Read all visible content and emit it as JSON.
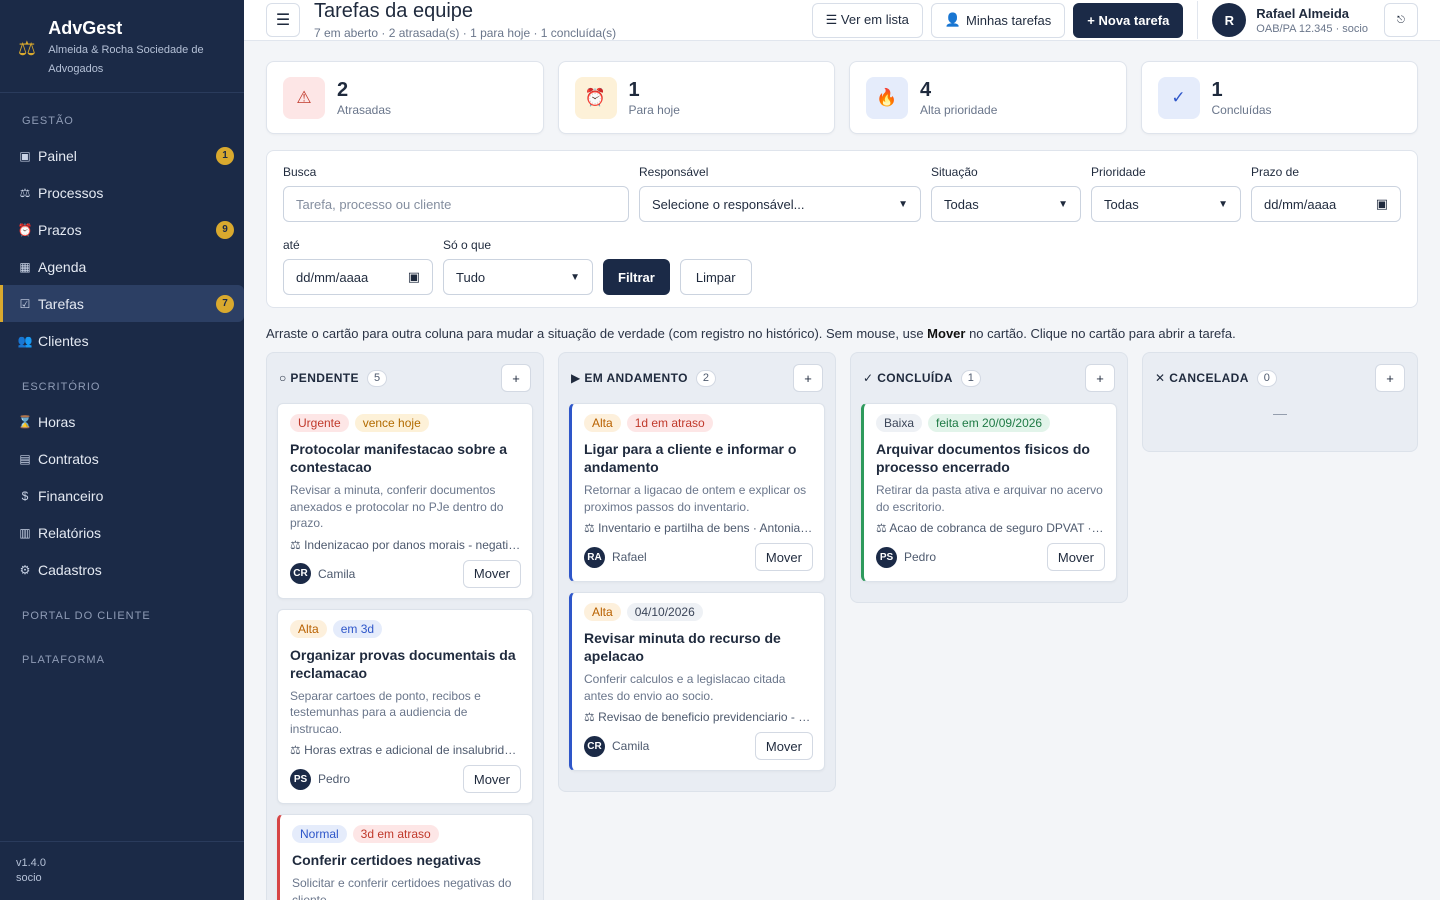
{
  "brand": {
    "name": "AdvGest",
    "subtitle": "Almeida & Rocha Sociedade de Advogados"
  },
  "sidebar": {
    "sections": [
      {
        "label": "GESTÃO",
        "items": [
          {
            "label": "Painel",
            "icon": "dashboard-icon",
            "glyph": "▣",
            "badge": "1"
          },
          {
            "label": "Processos",
            "icon": "scales-icon",
            "glyph": "⚖",
            "badge": ""
          },
          {
            "label": "Prazos",
            "icon": "alarm-icon",
            "glyph": "⏰",
            "badge": "9"
          },
          {
            "label": "Agenda",
            "icon": "calendar-icon",
            "glyph": "▦",
            "badge": ""
          },
          {
            "label": "Tarefas",
            "icon": "checkbox-icon",
            "glyph": "☑",
            "badge": "7",
            "active": true
          },
          {
            "label": "Clientes",
            "icon": "users-icon",
            "glyph": "👥",
            "badge": ""
          }
        ]
      },
      {
        "label": "ESCRITÓRIO",
        "items": [
          {
            "label": "Horas",
            "icon": "hourglass-icon",
            "glyph": "⌛",
            "badge": ""
          },
          {
            "label": "Contratos",
            "icon": "document-icon",
            "glyph": "▤",
            "badge": ""
          },
          {
            "label": "Financeiro",
            "icon": "money-bag-icon",
            "glyph": "$",
            "badge": ""
          },
          {
            "label": "Relatórios",
            "icon": "bar-chart-icon",
            "glyph": "▥",
            "badge": ""
          },
          {
            "label": "Cadastros",
            "icon": "gear-icon",
            "glyph": "⚙",
            "badge": ""
          }
        ]
      },
      {
        "label": "PORTAL DO CLIENTE",
        "items": []
      },
      {
        "label": "PLATAFORMA",
        "items": []
      }
    ],
    "version": "v1.4.0",
    "role": "socio"
  },
  "header": {
    "title": "Tarefas da equipe",
    "subtitle": "7 em aberto · 2 atrasada(s) · 1 para hoje · 1 concluída(s)",
    "btn_list": "☰ Ver em lista",
    "btn_mine": "Minhas tarefas",
    "btn_new": "+ Nova tarefa",
    "user_initial": "R",
    "user_name": "Rafael Almeida",
    "user_role": "OAB/PA 12.345 · socio"
  },
  "stats": [
    {
      "value": "2",
      "label": "Atrasadas",
      "icon": "warning-icon",
      "glyph": "⚠",
      "bg": "#fde6e6",
      "fg": "#c0392b"
    },
    {
      "value": "1",
      "label": "Para hoje",
      "icon": "alarm-clock-icon",
      "glyph": "⏰",
      "bg": "#fdf1d8",
      "fg": "#d0441f"
    },
    {
      "value": "4",
      "label": "Alta prioridade",
      "icon": "fire-icon",
      "glyph": "🔥",
      "bg": "#e5ecfb",
      "fg": "#e25822"
    },
    {
      "value": "1",
      "label": "Concluídas",
      "icon": "check-icon",
      "glyph": "✓",
      "bg": "#e5ecfb",
      "fg": "#2e56c9"
    }
  ],
  "filters": {
    "search_label": "Busca",
    "search_placeholder": "Tarefa, processo ou cliente",
    "resp_label": "Responsável",
    "resp_value": "Selecione o responsável...",
    "sit_label": "Situação",
    "sit_value": "Todas",
    "prio_label": "Prioridade",
    "prio_value": "Todas",
    "from_label": "Prazo de",
    "from_value": "dd/mm/aaaa",
    "to_label": "até",
    "to_value": "dd/mm/aaaa",
    "only_label": "Só o que",
    "only_value": "Tudo",
    "apply": "Filtrar",
    "clear": "Limpar"
  },
  "hint": {
    "before": "Arraste o cartão para outra coluna para mudar a situação de verdade (com registro no histórico). Sem mouse, use ",
    "bold": "Mover",
    "after": " no cartão. Clique no cartão para abrir a tarefa."
  },
  "board": [
    {
      "title": "○ PENDENTE",
      "count": "5",
      "add": "+",
      "empty": "",
      "cards": [
        {
          "border": "",
          "tags": [
            {
              "text": "Urgente",
              "cls": "t-urg"
            },
            {
              "text": "vence hoje",
              "cls": "t-today"
            }
          ],
          "title": "Protocolar manifestacao sobre a contestacao",
          "desc": "Revisar a minuta, conferir documentos anexados e protocolar no PJe dentro do prazo.",
          "proc": "⚖ Indenizacao por danos morais - negativacao indevida",
          "initials": "CR",
          "name": "Camila",
          "move": "Mover"
        },
        {
          "border": "",
          "tags": [
            {
              "text": "Alta",
              "cls": "t-alta"
            },
            {
              "text": "em 3d",
              "cls": "t-blue"
            }
          ],
          "title": "Organizar provas documentais da reclamacao",
          "desc": "Separar cartoes de ponto, recibos e testemunhas para a audiencia de instrucao.",
          "proc": "⚖ Horas extras e adicional de insalubridade",
          "initials": "PS",
          "name": "Pedro",
          "move": "Mover"
        },
        {
          "border": "bl-red",
          "tags": [
            {
              "text": "Normal",
              "cls": "t-normal"
            },
            {
              "text": "3d em atraso",
              "cls": "t-late"
            }
          ],
          "title": "Conferir certidoes negativas",
          "desc": "Solicitar e conferir certidoes negativas do cliente.",
          "proc": "",
          "initials": "",
          "name": "",
          "move": ""
        }
      ]
    },
    {
      "title": "▶ EM ANDAMENTO",
      "count": "2",
      "add": "+",
      "empty": "",
      "cards": [
        {
          "border": "bl-blue",
          "tags": [
            {
              "text": "Alta",
              "cls": "t-alta"
            },
            {
              "text": "1d em atraso",
              "cls": "t-late"
            }
          ],
          "title": "Ligar para a cliente e informar o andamento",
          "desc": "Retornar a ligacao de ontem e explicar os proximos passos do inventario.",
          "proc": "⚖ Inventario e partilha de bens · Antonia Pereira",
          "initials": "RA",
          "name": "Rafael",
          "move": "Mover"
        },
        {
          "border": "bl-blue",
          "tags": [
            {
              "text": "Alta",
              "cls": "t-alta"
            },
            {
              "text": "04/10/2026",
              "cls": "t-date"
            }
          ],
          "title": "Revisar minuta do recurso de apelacao",
          "desc": "Conferir calculos e a legislacao citada antes do envio ao socio.",
          "proc": "⚖ Revisao de beneficio previdenciario - aposentadoria",
          "initials": "CR",
          "name": "Camila",
          "move": "Mover"
        }
      ]
    },
    {
      "title": "✓ CONCLUÍDA",
      "count": "1",
      "add": "+",
      "empty": "",
      "cards": [
        {
          "border": "bl-green",
          "tags": [
            {
              "text": "Baixa",
              "cls": "t-baixa"
            },
            {
              "text": "feita em 20/09/2026",
              "cls": "t-done"
            }
          ],
          "title": "Arquivar documentos fisicos do processo encerrado",
          "desc": "Retirar da pasta ativa e arquivar no acervo do escritorio.",
          "proc": "⚖ Acao de cobranca de seguro DPVAT · Marcos Lima",
          "initials": "PS",
          "name": "Pedro",
          "move": "Mover"
        }
      ]
    },
    {
      "title": "✕ CANCELADA",
      "count": "0",
      "add": "+",
      "empty": "—",
      "cards": []
    }
  ]
}
